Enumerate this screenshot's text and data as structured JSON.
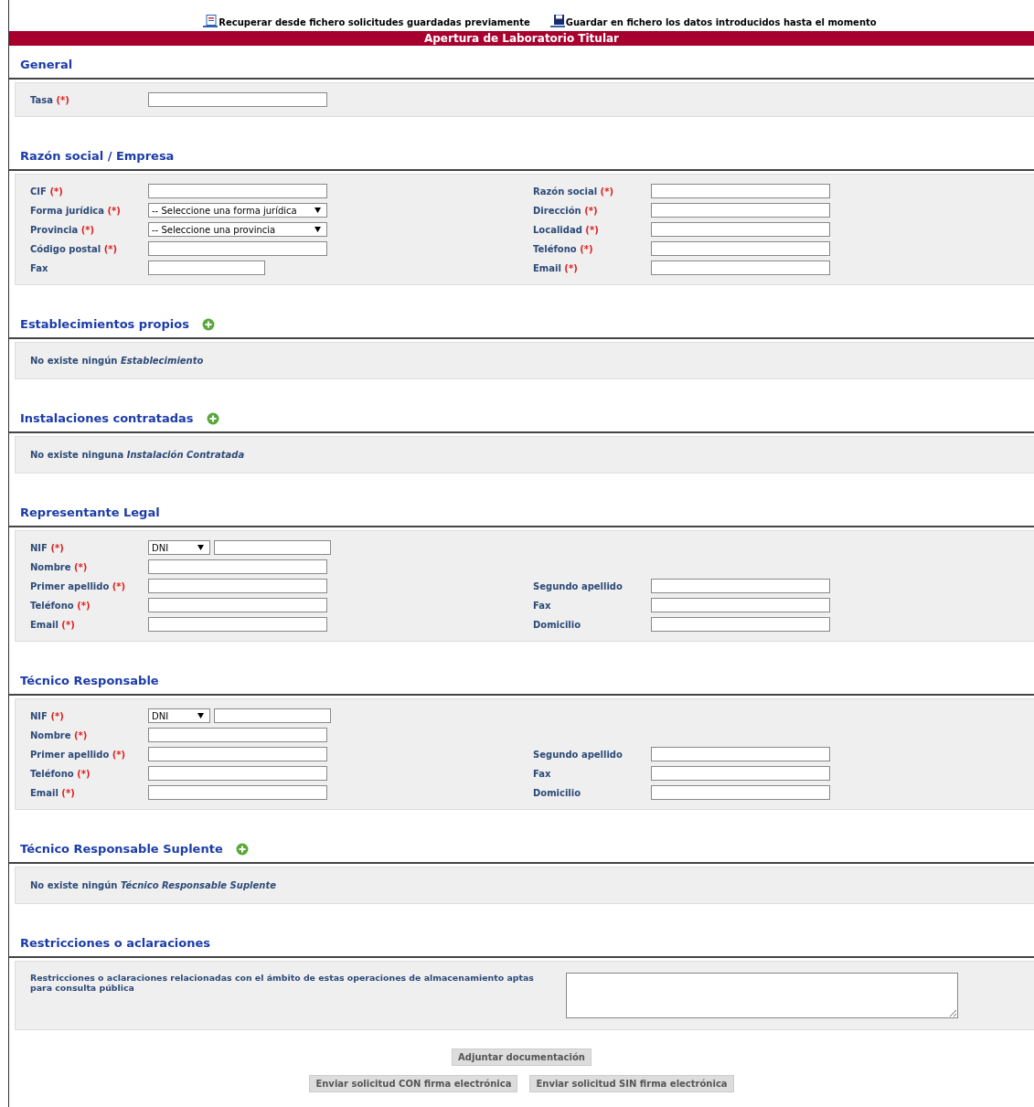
{
  "top_links": [
    {
      "kind": "load",
      "label": "Recuperar desde fichero solicitudes guardadas previamente"
    },
    {
      "kind": "save",
      "label": "Guardar en fichero los datos introducidos hasta el momento"
    }
  ],
  "title": "Apertura de Laboratorio Titular",
  "sections": [
    {
      "title": "General",
      "addable": false,
      "kind": "fields",
      "rows": [
        {
          "left": {
            "label": "Tasa",
            "required": "(*)",
            "kind": "text"
          }
        }
      ]
    },
    {
      "title": "Razón social / Empresa",
      "addable": false,
      "kind": "fields",
      "rows": [
        {
          "left": {
            "label": "CIF",
            "required": "(*)",
            "kind": "text"
          },
          "right": {
            "label": "Razón social",
            "required": "(*)",
            "kind": "text"
          }
        },
        {
          "left": {
            "label": "Forma jurídica",
            "required": "(*)",
            "kind": "select",
            "value": "-- Seleccione una forma jurídica"
          },
          "right": {
            "label": "Dirección",
            "required": "(*)",
            "kind": "text"
          }
        },
        {
          "left": {
            "label": "Provincia",
            "required": "(*)",
            "kind": "select",
            "value": "-- Seleccione una provincia"
          },
          "right": {
            "label": "Localidad",
            "required": "(*)",
            "kind": "text"
          }
        },
        {
          "left": {
            "label": "Código postal",
            "required": "(*)",
            "kind": "text"
          },
          "right": {
            "label": "Teléfono",
            "required": "(*)",
            "kind": "text"
          }
        },
        {
          "left": {
            "label": "Fax",
            "kind": "short"
          },
          "right": {
            "label": "Email",
            "required": "(*)",
            "kind": "text"
          }
        }
      ]
    },
    {
      "title": "Establecimientos propios",
      "addable": true,
      "kind": "empty",
      "message": "No existe ningún *Establecimiento*"
    },
    {
      "title": "Instalaciones contratadas",
      "addable": true,
      "kind": "empty",
      "message": "No existe ninguna *Instalación Contratada*"
    },
    {
      "title": "Representante Legal",
      "addable": false,
      "kind": "fields",
      "rows": [
        {
          "left": {
            "label": "NIF",
            "required": "(*)",
            "kind": "nif",
            "value": "DNI"
          }
        },
        {
          "left": {
            "label": "Nombre",
            "required": "(*)",
            "kind": "text"
          }
        },
        {
          "left": {
            "label": "Primer apellido",
            "required": "(*)",
            "kind": "text"
          },
          "right": {
            "label": "Segundo apellido",
            "kind": "text"
          }
        },
        {
          "left": {
            "label": "Teléfono",
            "required": "(*)",
            "kind": "text"
          },
          "right": {
            "label": "Fax",
            "kind": "text"
          }
        },
        {
          "left": {
            "label": "Email",
            "required": "(*)",
            "kind": "text"
          },
          "right": {
            "label": "Domicilio",
            "kind": "text"
          }
        }
      ]
    },
    {
      "title": "Técnico Responsable",
      "addable": false,
      "kind": "fields",
      "rows": [
        {
          "left": {
            "label": "NIF",
            "required": "(*)",
            "kind": "nif",
            "value": "DNI"
          }
        },
        {
          "left": {
            "label": "Nombre",
            "required": "(*)",
            "kind": "text"
          }
        },
        {
          "left": {
            "label": "Primer apellido",
            "required": "(*)",
            "kind": "text"
          },
          "right": {
            "label": "Segundo apellido",
            "kind": "text"
          }
        },
        {
          "left": {
            "label": "Teléfono",
            "required": "(*)",
            "kind": "text"
          },
          "right": {
            "label": "Fax",
            "kind": "text"
          }
        },
        {
          "left": {
            "label": "Email",
            "required": "(*)",
            "kind": "text"
          },
          "right": {
            "label": "Domicilio",
            "kind": "text"
          }
        }
      ]
    },
    {
      "title": "Técnico Responsable Suplente",
      "addable": true,
      "kind": "empty",
      "message": "No existe ningún *Técnico Responsable Suplente*"
    },
    {
      "title": "Restricciones o aclaraciones",
      "addable": false,
      "kind": "textarea",
      "label": "Restricciones o aclaraciones relacionadas con el ámbito de estas operaciones de almacenamiento aptas para consulta pública"
    }
  ],
  "attach_button": "Adjuntar documentación",
  "submit_buttons": [
    "Enviar solicitud CON firma electrónica",
    "Enviar solicitud SIN firma electrónica"
  ]
}
